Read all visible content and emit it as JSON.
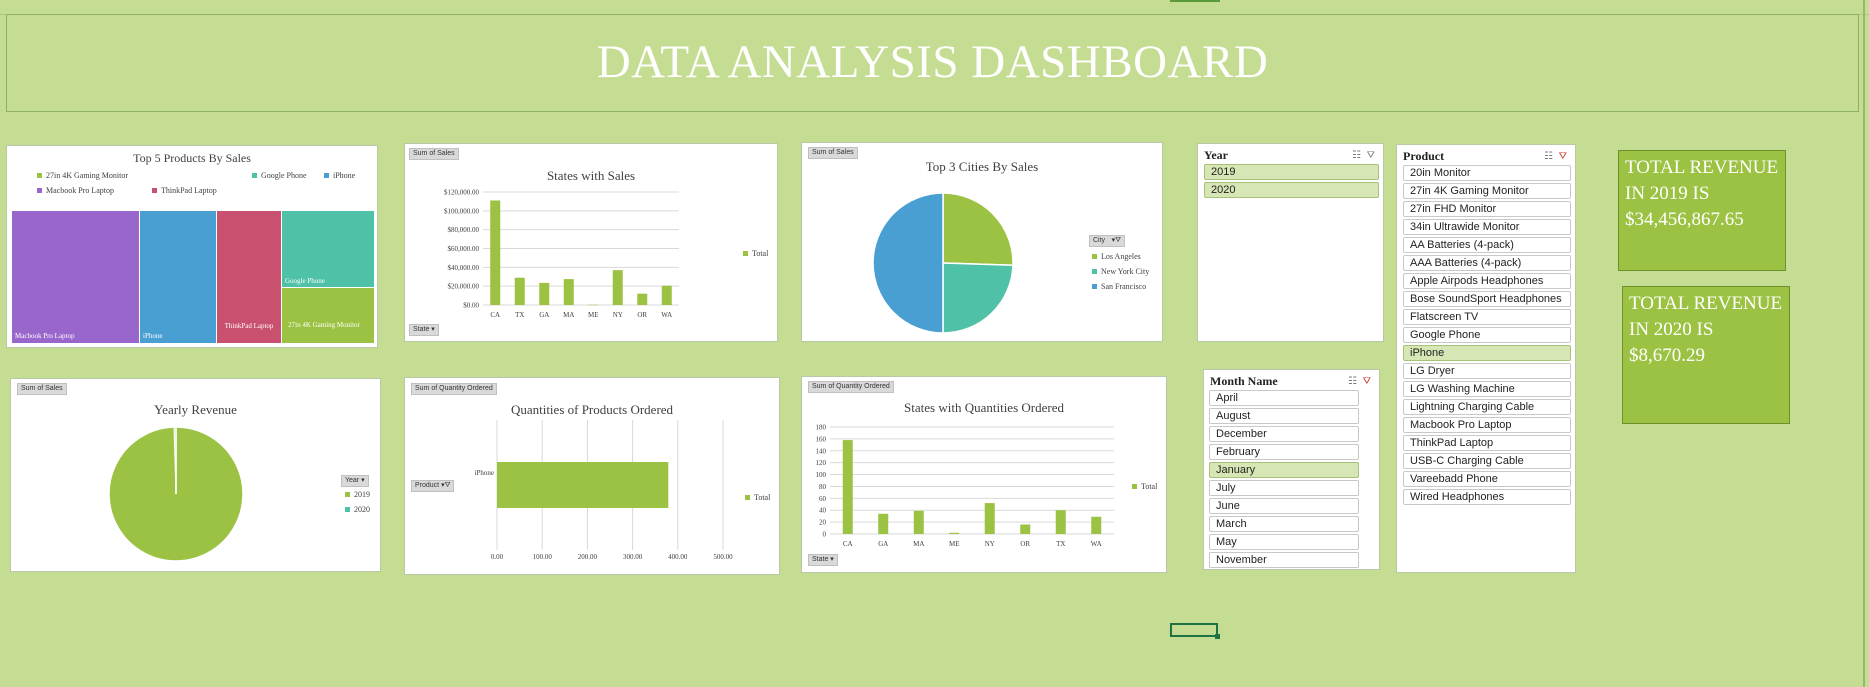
{
  "dashboard": {
    "title": "DATA ANALYSIS DASHBOARD"
  },
  "top_products": {
    "title": "Top 5 Products By Sales",
    "legend": [
      "27in 4K Gaming Monitor",
      "Google Phone",
      "iPhone",
      "Macbook Pro Laptop",
      "ThinkPad Laptop"
    ],
    "labels": {
      "macbook": "Macbook Pro Laptop",
      "iphone": "iPhone",
      "thinkpad": "ThinkPad Laptop",
      "google": "Google Phone",
      "gaming": "27in 4K Gaming Monitor"
    },
    "colors": [
      "#9bc242",
      "#4fc1a6",
      "#4a9fd2",
      "#9966cc",
      "#c9506e"
    ]
  },
  "states_sales": {
    "field_button": "Sum of Sales",
    "axis_button": "State",
    "legend_label": "Total"
  },
  "top_cities": {
    "field_button": "Sum of Sales",
    "title": "Top 3 Cities By Sales",
    "legend_button": "City",
    "legend": [
      "Los Angeles",
      "New York City",
      "San Francisco"
    ]
  },
  "yearly_revenue": {
    "field_button": "Sum of Sales",
    "title": "Yearly Revenue",
    "legend_button": "Year",
    "legend": [
      "2019",
      "2020"
    ]
  },
  "quantities_products": {
    "field_button": "Sum of Quantity Ordered",
    "axis_button": "Product",
    "legend_label": "Total"
  },
  "states_quantities": {
    "field_button": "Sum of Quantity Ordered",
    "axis_button": "State",
    "legend_label": "Total"
  },
  "chart_data": [
    {
      "type": "treemap",
      "title": "Top 5 Products By Sales",
      "categories": [
        "Macbook Pro Laptop",
        "iPhone",
        "ThinkPad Laptop",
        "Google Phone",
        "27in 4K Gaming Monitor"
      ]
    },
    {
      "type": "bar",
      "title": "States with Sales",
      "categories": [
        "CA",
        "TX",
        "GA",
        "MA",
        "ME",
        "NY",
        "OR",
        "WA"
      ],
      "values": [
        111000,
        29000,
        23500,
        27500,
        300,
        37000,
        12000,
        20500
      ],
      "yticks": [
        "$0.00",
        "$20,000.00",
        "$40,000.00",
        "$60,000.00",
        "$80,000.00",
        "$100,000.00",
        "$120,000.00"
      ],
      "ylim": [
        0,
        120000
      ],
      "series": [
        {
          "name": "Total"
        }
      ]
    },
    {
      "type": "pie",
      "title": "Top 3 Cities By Sales",
      "categories": [
        "Los Angeles",
        "New York City",
        "San Francisco"
      ],
      "values": [
        25.5,
        24.5,
        50.0
      ],
      "colors": [
        "#9bc242",
        "#4fc1a6",
        "#4a9fd2"
      ]
    },
    {
      "type": "pie",
      "title": "Yearly Revenue",
      "categories": [
        "2019",
        "2020"
      ],
      "values": [
        34456867.65,
        8670.29
      ],
      "colors": [
        "#9bc242",
        "#4fc1a6"
      ]
    },
    {
      "type": "bar",
      "orientation": "horizontal",
      "title": "Quantities of Products Ordered",
      "categories": [
        "iPhone"
      ],
      "values": [
        379
      ],
      "xticks": [
        "0.00",
        "100.00",
        "200.00",
        "300.00",
        "400.00",
        "500.00"
      ],
      "xlim": [
        0,
        500
      ],
      "series": [
        {
          "name": "Total"
        }
      ]
    },
    {
      "type": "bar",
      "title": "States with Quantities Ordered",
      "categories": [
        "CA",
        "GA",
        "MA",
        "ME",
        "NY",
        "OR",
        "TX",
        "WA"
      ],
      "values": [
        158,
        34,
        39,
        2,
        52,
        16,
        40,
        29
      ],
      "yticks": [
        "0",
        "20",
        "40",
        "60",
        "80",
        "100",
        "120",
        "140",
        "160",
        "180"
      ],
      "ylim": [
        0,
        180
      ],
      "series": [
        {
          "name": "Total"
        }
      ]
    }
  ],
  "year_slicer": {
    "title": "Year",
    "items": [
      "2019",
      "2020"
    ]
  },
  "month_slicer": {
    "title": "Month Name",
    "items": [
      "April",
      "August",
      "December",
      "February",
      "January",
      "July",
      "June",
      "March",
      "May",
      "November"
    ],
    "selected": "January"
  },
  "product_slicer": {
    "title": "Product",
    "items": [
      "20in Monitor",
      "27in 4K Gaming Monitor",
      "27in FHD Monitor",
      "34in Ultrawide Monitor",
      "AA Batteries (4-pack)",
      "AAA Batteries (4-pack)",
      "Apple Airpods Headphones",
      "Bose SoundSport Headphones",
      "Flatscreen TV",
      "Google Phone",
      "iPhone",
      "LG Dryer",
      "LG Washing Machine",
      "Lightning Charging Cable",
      "Macbook Pro Laptop",
      "ThinkPad Laptop",
      "USB-C Charging Cable",
      "Vareebadd Phone",
      "Wired Headphones"
    ],
    "selected": "iPhone"
  },
  "revenue_2019": {
    "text": "TOTAL REVENUE IN 2019 IS $34,456,867.65"
  },
  "revenue_2020": {
    "text": "TOTAL REVENUE IN 2020 IS $8,670.29"
  }
}
